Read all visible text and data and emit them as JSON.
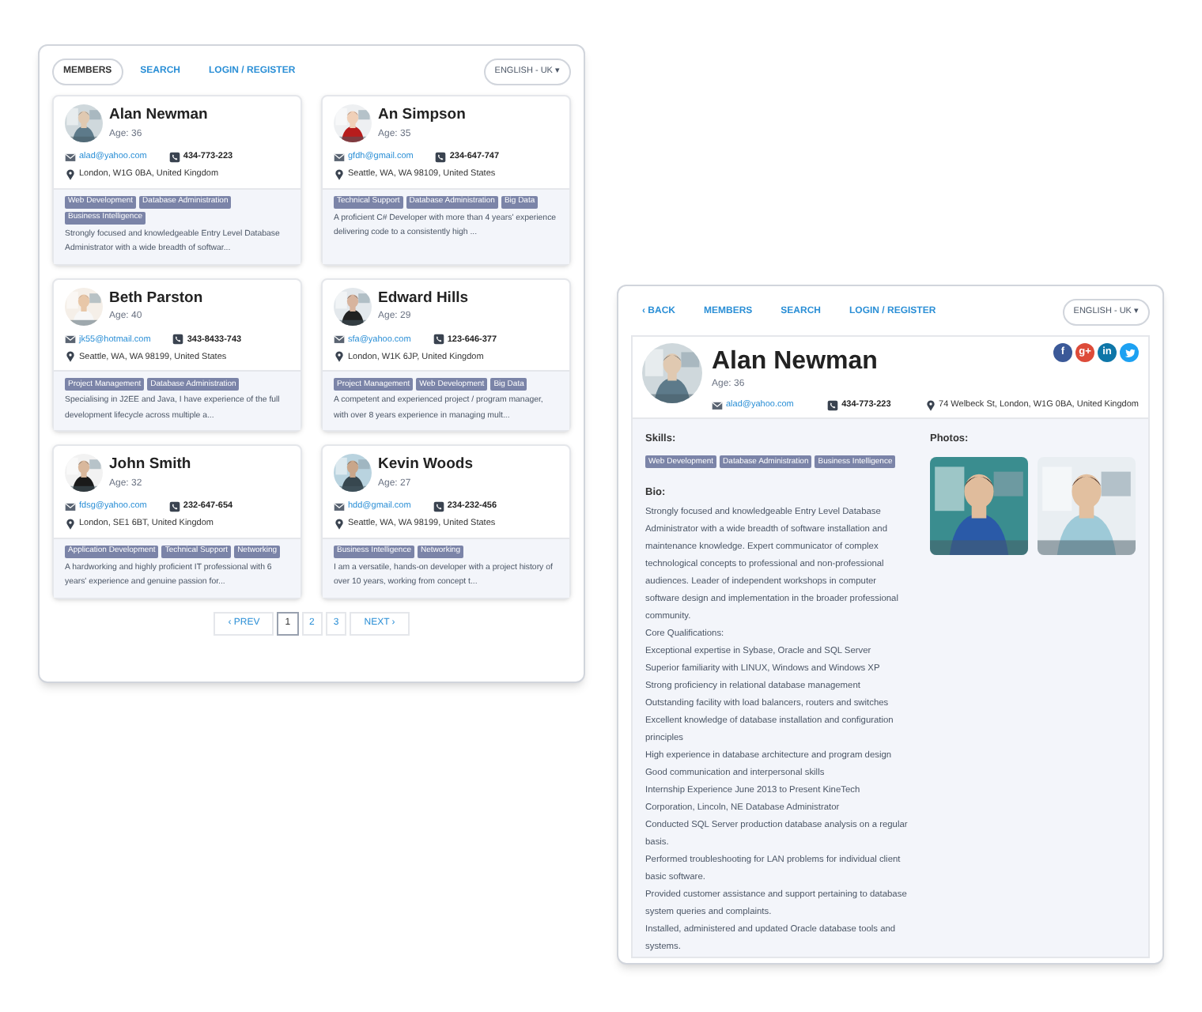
{
  "members_window": {
    "nav": [
      {
        "label": "MEMBERS",
        "selected": true
      },
      {
        "label": "SEARCH",
        "selected": false
      },
      {
        "label": "LOGIN / REGISTER",
        "selected": false
      }
    ],
    "language": "ENGLISH - UK ▾",
    "members": [
      {
        "name": "Alan Newman",
        "age": "Age: 36",
        "email": "alad@yahoo.com",
        "phone": "434-773-223",
        "address": "London, W1G 0BA, United Kingdom",
        "tags": [
          "Web Development",
          "Database Administration",
          "Business Intelligence"
        ],
        "summary": "Strongly focused and knowledgeable Entry Level Database Administrator with a wide breadth of softwar..."
      },
      {
        "name": "An Simpson",
        "age": "Age: 35",
        "email": "gfdh@gmail.com",
        "phone": "234-647-747",
        "address": "Seattle, WA, WA 98109, United States",
        "tags": [
          "Technical Support",
          "Database Administration",
          "Big Data"
        ],
        "summary": "A proficient C# Developer with more than 4 years' experience delivering code to a consistently high ..."
      },
      {
        "name": "Beth Parston",
        "age": "Age: 40",
        "email": "jk55@hotmail.com",
        "phone": "343-8433-743",
        "address": "Seattle, WA, WA 98199, United States",
        "tags": [
          "Project Management",
          "Database Administration"
        ],
        "summary": "Specialising in J2EE and Java, I have experience of the full development lifecycle across multiple a..."
      },
      {
        "name": "Edward Hills",
        "age": "Age: 29",
        "email": "sfa@yahoo.com",
        "phone": "123-646-377",
        "address": "London, W1K 6JP, United Kingdom",
        "tags": [
          "Project Management",
          "Web Development",
          "Big Data"
        ],
        "summary": "A competent and experienced project / program manager, with over 8 years experience in managing mult..."
      },
      {
        "name": "John Smith",
        "age": "Age: 32",
        "email": "fdsg@yahoo.com",
        "phone": "232-647-654",
        "address": "London, SE1 6BT, United Kingdom",
        "tags": [
          "Application Development",
          "Technical Support",
          "Networking"
        ],
        "summary": "A hardworking and highly proficient IT professional with 6 years' experience and genuine passion for..."
      },
      {
        "name": "Kevin Woods",
        "age": "Age: 27",
        "email": "hdd@gmail.com",
        "phone": "234-232-456",
        "address": "Seattle, WA, WA 98199, United States",
        "tags": [
          "Business Intelligence",
          "Networking"
        ],
        "summary": "I am a versatile, hands-on developer with a project history of over 10 years, working from concept t..."
      }
    ],
    "pagination": [
      {
        "label": "‹ PREV",
        "selected": false
      },
      {
        "label": "1",
        "selected": true
      },
      {
        "label": "2",
        "selected": false
      },
      {
        "label": "3",
        "selected": false
      },
      {
        "label": "NEXT ›",
        "selected": false
      }
    ]
  },
  "profile_window": {
    "nav": [
      {
        "label": "‹ BACK",
        "selected": false
      },
      {
        "label": "MEMBERS",
        "selected": false
      },
      {
        "label": "SEARCH",
        "selected": false
      },
      {
        "label": "LOGIN / REGISTER",
        "selected": false
      }
    ],
    "language": "ENGLISH - UK ▾",
    "profile": {
      "name": "Alan Newman",
      "age": "Age: 36",
      "email": "alad@yahoo.com",
      "phone": "434-773-223",
      "address": "74 Welbeck St, London, W1G 0BA, United Kingdom"
    },
    "social": [
      {
        "kind": "letter",
        "label": "f",
        "color": "#3b5998"
      },
      {
        "kind": "letter",
        "label": "g+",
        "color": "#dd4b39"
      },
      {
        "kind": "letter",
        "label": "in",
        "color": "#0e76a8"
      },
      {
        "kind": "bird",
        "color": "#1da1f2"
      }
    ],
    "skills_label": "Skills:",
    "skills": [
      "Web Development",
      "Database Administration",
      "Business Intelligence"
    ],
    "photos_label": "Photos:",
    "bio_label": "Bio:",
    "bio": [
      "Strongly focused and knowledgeable Entry Level Database Administrator with a wide breadth of software installation and maintenance knowledge. Expert communicator of complex technological concepts to professional and non-professional audiences. Leader of independent workshops in computer software design and implementation in the broader professional community.",
      "Core Qualifications:",
      "Exceptional expertise in Sybase, Oracle and SQL Server",
      "Superior familiarity with LINUX, Windows and Windows XP",
      "Strong proficiency in relational database management",
      "Outstanding facility with load balancers, routers and switches",
      "Excellent knowledge of database installation and configuration principles",
      "High experience in database architecture and program design",
      "Good communication and interpersonal skills",
      "Internship Experience June 2013 to Present KineTech Corporation, Lincoln, NE Database Administrator",
      "Conducted SQL Server production database analysis on a regular basis.",
      "Performed troubleshooting for LAN problems for individual client basic software.",
      "Provided customer assistance and support pertaining to database system queries and complaints.",
      "Installed, administered and updated Oracle database tools and systems."
    ]
  }
}
